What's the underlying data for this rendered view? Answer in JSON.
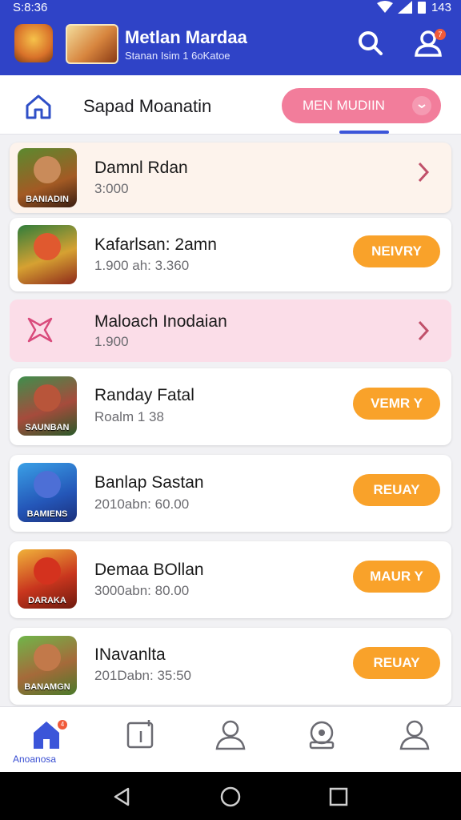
{
  "status": {
    "time": "S:8:36",
    "battery": "143"
  },
  "header": {
    "title": "Metlan Mardaa",
    "subtitle": "Stanan Isim 1 6oKatoe",
    "notify_badge": "7"
  },
  "tabs": {
    "label": "Sapad Moanatin",
    "pill_label": "MEN MUDIIN"
  },
  "games": [
    {
      "name": "Damnl Rdan",
      "meta": "3:000",
      "thumb_caption": "BANIADIN",
      "action": "",
      "style": "peach"
    },
    {
      "name": "Kafarlsan: 2amn",
      "meta": "1.900 ah: 3.360",
      "thumb_caption": "",
      "action": "NEIVRY",
      "style": "white"
    },
    {
      "name": "Maloach Inodaian",
      "meta": "1.900",
      "thumb_caption": "",
      "action": "",
      "style": "pink"
    },
    {
      "name": "Randay Fatal",
      "meta": "Roalm 1 38",
      "thumb_caption": "SAUNBAN",
      "action": "VEMR Y",
      "style": "white"
    },
    {
      "name": "Banlap Sastan",
      "meta": "2010abn: 60.00",
      "thumb_caption": "BAMIENS",
      "action": "REUAY",
      "style": "white"
    },
    {
      "name": "Demaa BOllan",
      "meta": "3000abn: 80.00",
      "thumb_caption": "DARAKA",
      "action": "MAUR Y",
      "style": "white"
    },
    {
      "name": "INavanlta",
      "meta": "201Dabn: 35:50",
      "thumb_caption": "BANAMGN",
      "action": "REUAY",
      "style": "white"
    }
  ],
  "bottom_nav": {
    "home_label": "Anoanosa",
    "home_badge": "4"
  },
  "colors": {
    "primary": "#2f43c7",
    "accent_pink": "#f27d9b",
    "play_orange": "#f9a22a"
  }
}
